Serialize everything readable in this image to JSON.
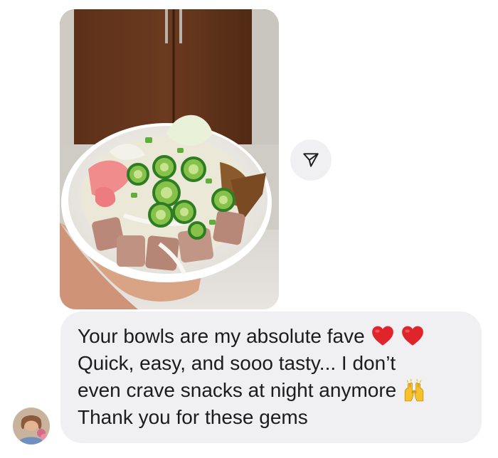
{
  "conversation": {
    "message": {
      "lines": [
        "Your bowls are my absolute fave",
        "Quick, easy, and sooo tasty... I don’t",
        "even crave snacks at night anymore",
        "Thank you for these gems"
      ],
      "emojis": [
        "red-heart",
        "red-heart",
        "raising-hands"
      ]
    },
    "share_icon": "paper-plane-icon",
    "colors": {
      "bubble_bg": "#f0f0f2",
      "text": "#1c1c1e",
      "heart": "#e0242b",
      "hands": "#f6c12b"
    }
  }
}
